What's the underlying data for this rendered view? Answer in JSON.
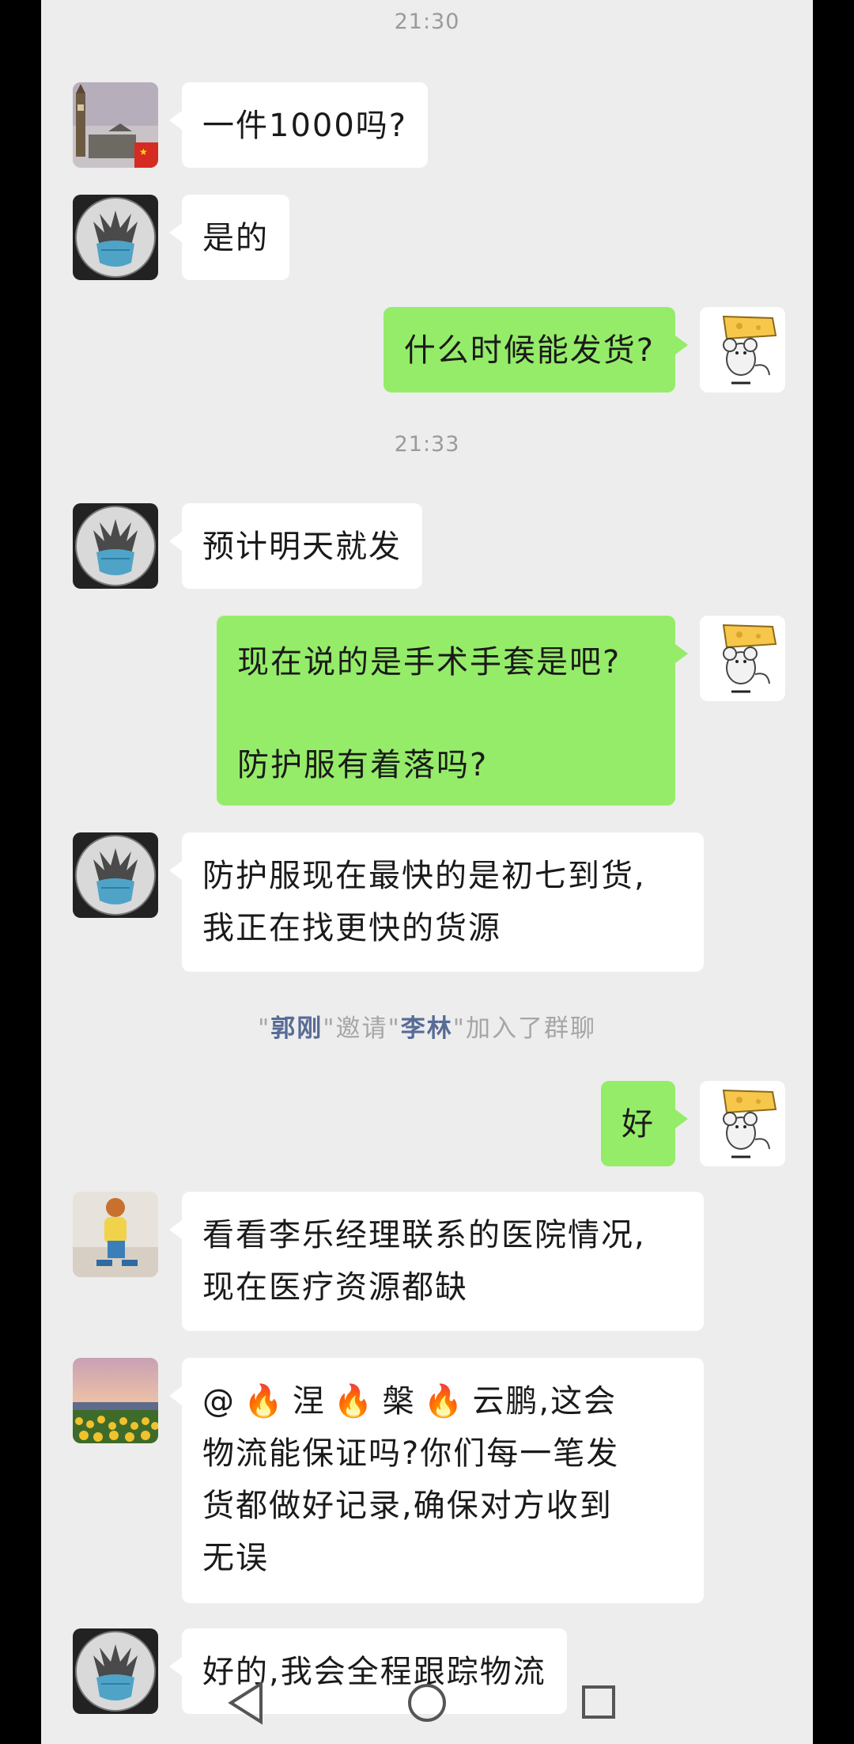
{
  "messages": [
    {
      "type": "time",
      "text": "21:30"
    },
    {
      "type": "in",
      "avatar": "big-ben-avatar",
      "text": "一件1000吗?"
    },
    {
      "type": "in",
      "avatar": "wolf-mask-avatar",
      "text": "是的"
    },
    {
      "type": "out",
      "avatar": "mouse-cheese-avatar",
      "text": "什么时候能发货?"
    },
    {
      "type": "time",
      "text": "21:33"
    },
    {
      "type": "in",
      "avatar": "wolf-mask-avatar",
      "text": "预计明天就发"
    },
    {
      "type": "out",
      "avatar": "mouse-cheese-avatar",
      "lines": [
        "现在说的是手术手套是吧?",
        "防护服有着落吗?"
      ]
    },
    {
      "type": "in",
      "avatar": "wolf-mask-avatar",
      "lines": [
        "防护服现在最快的是初七到货,",
        "我正在找更快的货源"
      ]
    },
    {
      "type": "system",
      "inviter": "郭刚",
      "action": "邀请",
      "invitee": "李林",
      "suffix": "加入了群聊",
      "quote": "\""
    },
    {
      "type": "out",
      "avatar": "mouse-cheese-avatar",
      "text": "好"
    },
    {
      "type": "in",
      "avatar": "child-photo-avatar",
      "lines": [
        "看看李乐经理联系的医院情况,",
        "现在医疗资源都缺"
      ]
    },
    {
      "type": "in",
      "avatar": "sunflower-field-avatar",
      "mention": "@",
      "name_parts": [
        "涅",
        "槃",
        "云鹏,这会"
      ],
      "lines": [
        "物流能保证吗?你们每一笔发",
        "货都做好记录,确保对方收到",
        "无误"
      ]
    },
    {
      "type": "in",
      "avatar": "wolf-mask-avatar",
      "text": "好的,我会全程跟踪物流"
    }
  ],
  "fire_emoji": "🔥",
  "colors": {
    "background": "#ededed",
    "bubble_out": "#95ec69",
    "bubble_in": "#ffffff",
    "name_link": "#576b95"
  }
}
